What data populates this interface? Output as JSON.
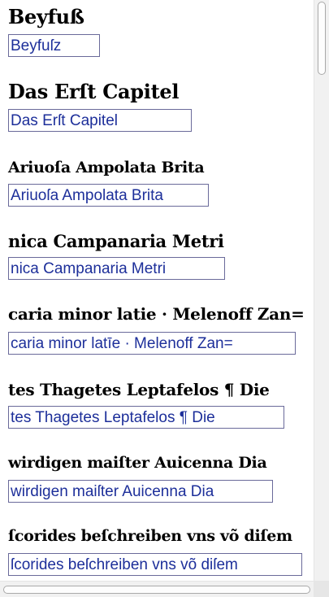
{
  "entries": [
    {
      "scan": "Beyfuß",
      "transcription": "Beyfuſz"
    },
    {
      "scan": "Das Erſt Capitel",
      "transcription": "Das Erſt Capitel"
    },
    {
      "scan": "Ariuoſa Ampolata Brita",
      "transcription": "Ariuoſa Ampolata Brita"
    },
    {
      "scan": "nica Campanaria Metri",
      "transcription": "nica Campanaria Metri"
    },
    {
      "scan": "caria minor latie · Melenoff Zan=",
      "transcription": "caria minor latīe · Melenoff Zan="
    },
    {
      "scan": "tes Thagetes Leptafelos ¶ Die",
      "transcription": "tes Thagetes Leptafelos ¶ Die"
    },
    {
      "scan": "wirdigen maiſter Auicenna Dia",
      "transcription": "wirdigen maiſter Auicenna Dia"
    },
    {
      "scan": "ſcorides beſchreiben vns võ diſem",
      "transcription": "ſcorides beſchreiben vns võ diſem"
    }
  ]
}
